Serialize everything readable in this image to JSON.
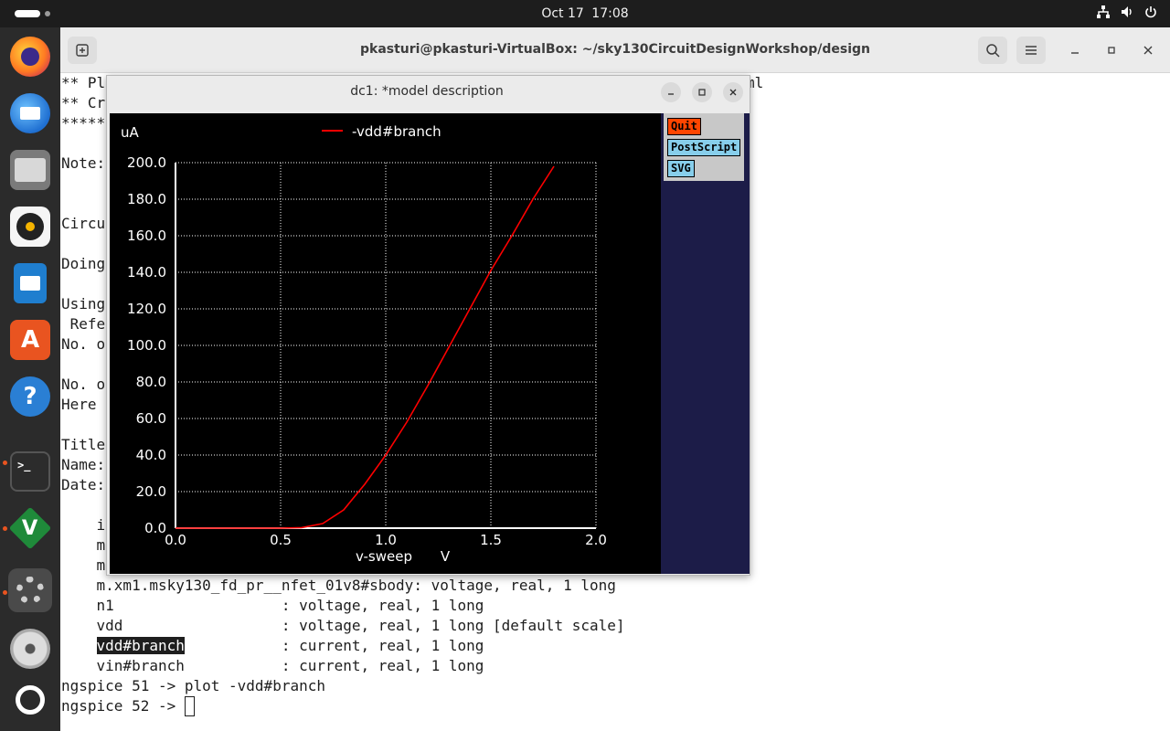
{
  "topbar": {
    "date": "Oct 17",
    "time": "17:08"
  },
  "dock": {
    "apps": [
      "firefox-icon",
      "thunderbird-icon",
      "files-icon",
      "rhythmbox-icon",
      "writer-icon",
      "app-center-icon",
      "help-icon",
      "terminal-icon",
      "vim-icon",
      "settings-icon",
      "disc-icon",
      "ubuntu-icon"
    ]
  },
  "terminal": {
    "title": "pkasturi@pkasturi-VirtualBox: ~/sky130CircuitDesignWorkshop/design",
    "lines": [
      "** Pl",
      "** Cr",
      "*****",
      "",
      "Note:",
      "",
      "",
      "Circu",
      "",
      "Doing",
      "",
      "Using",
      " Refe",
      "No. o",
      "",
      "No. o",
      "Here ",
      "",
      "Title",
      "Name:",
      "Date:",
      "",
      "    i",
      "    m",
      "    m",
      "    m.xm1.msky130_fd_pr__nfet_01v8#sbody: voltage, real, 1 long",
      "    n1                   : voltage, real, 1 long",
      "    vdd                  : voltage, real, 1 long [default scale]",
      "    vdd#branch           : current, real, 1 long",
      "    vin#branch           : current, real, 1 long",
      "ngspice 51 -> plot -vdd#branch",
      "ngspice 52 -> "
    ],
    "right_fragment": "ml",
    "selected_text": "vdd#branch"
  },
  "plot_window": {
    "title": "dc1: *model description",
    "buttons": [
      "Quit",
      "PostScript",
      "SVG"
    ]
  },
  "chart_data": {
    "type": "line",
    "ylabel": "uA",
    "xlabel": "v-sweep",
    "xunit": "V",
    "xlim": [
      0.0,
      2.0
    ],
    "ylim": [
      0.0,
      200.0
    ],
    "xticks": [
      "0.0",
      "0.5",
      "1.0",
      "1.5",
      "2.0"
    ],
    "yticks": [
      "0.0",
      "20.0",
      "40.0",
      "60.0",
      "80.0",
      "100.0",
      "120.0",
      "140.0",
      "160.0",
      "180.0",
      "200.0"
    ],
    "grid": true,
    "legend": "top-center",
    "series": [
      {
        "name": "-vdd#branch",
        "color": "#ff0000",
        "x": [
          0.0,
          0.1,
          0.2,
          0.3,
          0.4,
          0.5,
          0.6,
          0.7,
          0.8,
          0.9,
          1.0,
          1.1,
          1.2,
          1.3,
          1.4,
          1.5,
          1.6,
          1.7,
          1.8
        ],
        "y": [
          0,
          0,
          0,
          0,
          0,
          0,
          0.3,
          2.5,
          10,
          24,
          40,
          58,
          78,
          99,
          120,
          141,
          160,
          180,
          198
        ]
      }
    ]
  }
}
